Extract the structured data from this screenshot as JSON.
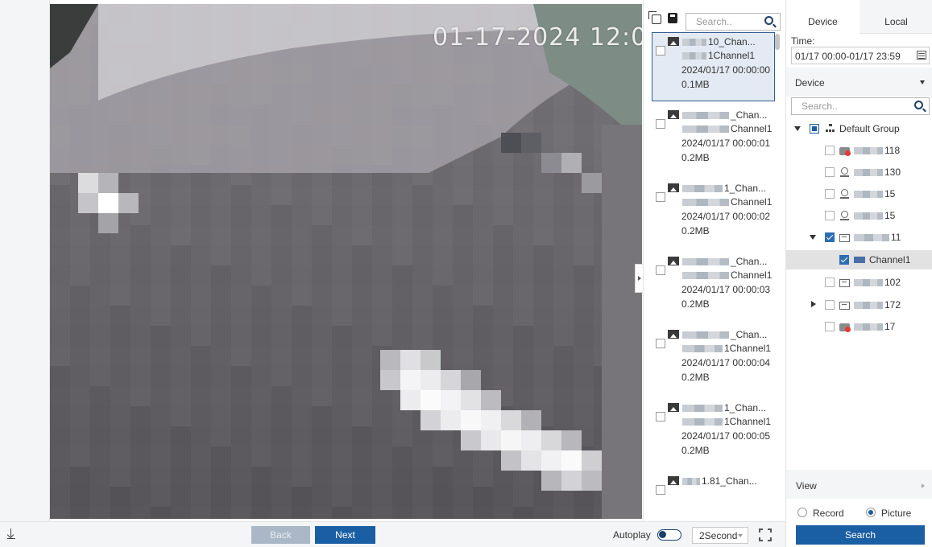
{
  "image": {
    "osd_timestamp": "01-17-2024 12:0("
  },
  "bottom_bar": {
    "back_label": "Back",
    "next_label": "Next",
    "autoplay_label": "Autoplay",
    "interval_value": "2Second"
  },
  "results": {
    "search_placeholder": "Search..",
    "items": [
      {
        "line1": "10_Chan...",
        "line2": "1Channel1",
        "line3": "2024/01/17 00:00:00",
        "line4": "0.1MB",
        "selected": true
      },
      {
        "line1": "_Chan...",
        "line2": "Channel1",
        "line3": "2024/01/17 00:00:01",
        "line4": "0.2MB",
        "selected": false
      },
      {
        "line1": "1_Chan...",
        "line2": "Channel1",
        "line3": "2024/01/17 00:00:02",
        "line4": "0.2MB",
        "selected": false
      },
      {
        "line1": "_Chan...",
        "line2": "Channel1",
        "line3": "2024/01/17 00:00:03",
        "line4": "0.2MB",
        "selected": false
      },
      {
        "line1": "_Chan...",
        "line2": "1Channel1",
        "line3": "2024/01/17 00:00:04",
        "line4": "0.2MB",
        "selected": false
      },
      {
        "line1": "1_Chan...",
        "line2": "1Channel1",
        "line3": "2024/01/17 00:00:05",
        "line4": "0.2MB",
        "selected": false
      },
      {
        "line1": "1.81_Chan...",
        "line2": "",
        "line3": "",
        "line4": "",
        "selected": false
      }
    ]
  },
  "panel": {
    "tab_device": "Device",
    "tab_local": "Local",
    "time_label": "Time:",
    "time_value": "01/17 00:00-01/17 23:59",
    "device_dropdown": "Device",
    "search_placeholder": "Search..",
    "tree": {
      "group": "Default Group",
      "nodes": [
        {
          "label": "118",
          "icon": "camera-offline-icon"
        },
        {
          "label": "130",
          "icon": "location-icon"
        },
        {
          "label": "15",
          "icon": "location-icon"
        },
        {
          "label": "15",
          "icon": "location-icon"
        },
        {
          "label": "11",
          "icon": "nvr-icon"
        },
        {
          "label": "Channel1",
          "icon": "channel-icon"
        },
        {
          "label": "102",
          "icon": "nvr-icon"
        },
        {
          "label": "172",
          "icon": "nvr-icon"
        },
        {
          "label": "17",
          "icon": "camera-offline-icon"
        }
      ]
    },
    "view_label": "View",
    "record_label": "Record",
    "picture_label": "Picture",
    "search_button": "Search"
  },
  "colors": {
    "primary": "#1a5ea3",
    "selection": "#e4eaf3",
    "panel_bg": "#f4f5f6"
  }
}
